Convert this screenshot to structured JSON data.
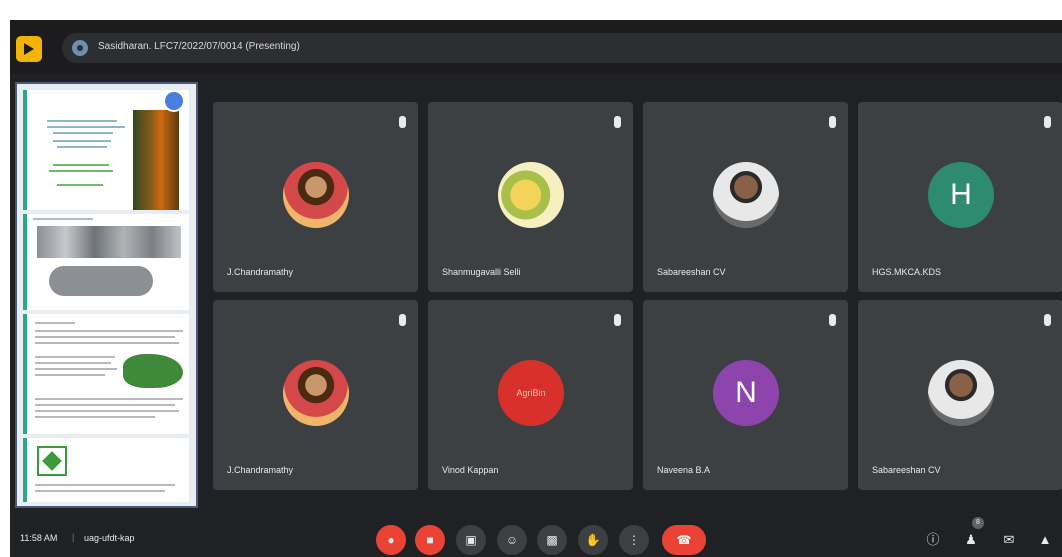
{
  "header": {
    "title": "Sasidharan. LFC7/2022/07/0014 (Presenting)",
    "logo_icon": "meet-logo-icon",
    "present_icon": "presenting-icon"
  },
  "participants": [
    {
      "name": "J.Chandramathy",
      "avatar": "photo"
    },
    {
      "name": "Shanmugavalli Selli",
      "avatar": "photo"
    },
    {
      "name": "Sabareeshan CV",
      "avatar": "photo"
    },
    {
      "name": "HGS.MKCA.KDS",
      "avatar": "H",
      "color": "#2e8b6e"
    },
    {
      "name": "J.Chandramathy",
      "avatar": "photo"
    },
    {
      "name": "Vinod Kappan",
      "avatar": "logo",
      "logo_text": "AgriBin"
    },
    {
      "name": "Naveena B.A",
      "avatar": "N",
      "color": "#8e44ad"
    },
    {
      "name": "Sabareeshan CV",
      "avatar": "photo"
    }
  ],
  "footer": {
    "time": "11:58 AM",
    "separator": "|",
    "meeting_code": "uag-ufdt-kap",
    "people_count": "8"
  },
  "controls": {
    "mic": "mic-off-icon",
    "camera": "camera-off-icon",
    "captions": "captions-icon",
    "emoji": "emoji-icon",
    "present": "present-screen-icon",
    "raise_hand": "raise-hand-icon",
    "more": "more-options-icon",
    "end_call": "end-call-icon",
    "info": "info-icon",
    "people": "people-icon",
    "chat": "chat-icon",
    "activities": "activities-icon"
  },
  "colors": {
    "background": "#202124",
    "tile": "#3c4043",
    "danger": "#ea4335",
    "logo": "#f2b400",
    "slide_accent": "#2ca58d"
  }
}
